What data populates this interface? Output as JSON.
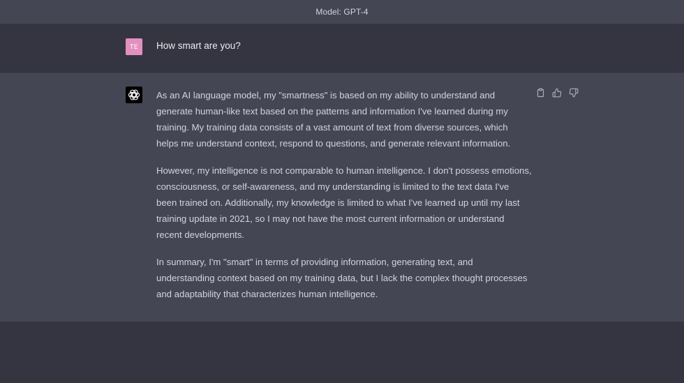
{
  "header": {
    "model_label": "Model: GPT-4"
  },
  "conversation": {
    "user": {
      "avatar_initials": "TE",
      "avatar_color": "#e38fc0",
      "message": "How smart are you?"
    },
    "assistant": {
      "avatar_icon": "openai-logo-icon",
      "paragraphs": [
        "As an AI language model, my \"smartness\" is based on my ability to understand and generate human-like text based on the patterns and information I've learned during my training. My training data consists of a vast amount of text from diverse sources, which helps me understand context, respond to questions, and generate relevant information.",
        "However, my intelligence is not comparable to human intelligence. I don't possess emotions, consciousness, or self-awareness, and my understanding is limited to the text data I've been trained on. Additionally, my knowledge is limited to what I've learned up until my last training update in 2021, so I may not have the most current information or understand recent developments.",
        "In summary, I'm \"smart\" in terms of providing information, generating text, and understanding context based on my training data, but I lack the complex thought processes and adaptability that characterizes human intelligence."
      ],
      "actions": [
        "copy-icon",
        "thumbs-up-icon",
        "thumbs-down-icon"
      ]
    }
  },
  "colors": {
    "background": "#343541",
    "assistant_background": "#444654",
    "text": "#d1d5db"
  }
}
